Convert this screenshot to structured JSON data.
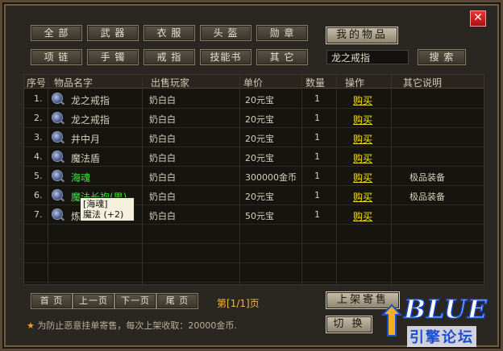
{
  "close_label": "✕",
  "categories_row1": [
    "全 部",
    "武 器",
    "衣 服",
    "头 盔",
    "勋 章"
  ],
  "categories_row2": [
    "项 链",
    "手 镯",
    "戒 指",
    "技能书",
    "其 它"
  ],
  "my_items_label": "我的物品",
  "search": {
    "value": "龙之戒指",
    "button": "搜 索"
  },
  "table": {
    "headers": [
      "序号",
      "物品名字",
      "出售玩家",
      "单价",
      "数量",
      "操作",
      "其它说明"
    ],
    "rows": [
      {
        "idx": "1.",
        "name": "龙之戒指",
        "seller": "奶白白",
        "price": "20元宝",
        "qty": "1",
        "action": "购买",
        "note": "",
        "green": false
      },
      {
        "idx": "2.",
        "name": "龙之戒指",
        "seller": "奶白白",
        "price": "20元宝",
        "qty": "1",
        "action": "购买",
        "note": "",
        "green": false
      },
      {
        "idx": "3.",
        "name": "井中月",
        "seller": "奶白白",
        "price": "20元宝",
        "qty": "1",
        "action": "购买",
        "note": "",
        "green": false
      },
      {
        "idx": "4.",
        "name": "魔法盾",
        "seller": "奶白白",
        "price": "20元宝",
        "qty": "1",
        "action": "购买",
        "note": "",
        "green": false
      },
      {
        "idx": "5.",
        "name": "海魂",
        "seller": "奶白白",
        "price": "300000金币",
        "qty": "1",
        "action": "购买",
        "note": "极品装备",
        "green": true
      },
      {
        "idx": "6.",
        "name": "魔法长袍(男)",
        "seller": "奶白白",
        "price": "20元宝",
        "qty": "1",
        "action": "购买",
        "note": "极品装备",
        "green": true
      },
      {
        "idx": "7.",
        "name": "炼",
        "seller": "奶白白",
        "price": "50元宝",
        "qty": "1",
        "action": "购买",
        "note": "",
        "green": false
      }
    ]
  },
  "tooltip": {
    "line1": "[海魂]",
    "line2": "魔法 (+2)"
  },
  "pager": {
    "first": "首 页",
    "prev": "上一页",
    "next": "下一页",
    "last": "尾 页",
    "info": "第[1/1]页"
  },
  "list_button": "上架寄售",
  "switch_button": "切 换",
  "notice": {
    "star": "★",
    "text": "为防止恶意挂单寄售，每次上架收取：20000金币."
  },
  "logo": {
    "main": "BLUE",
    "sub": "引擎论坛"
  },
  "colors": {
    "accent_yellow": "#f0e020",
    "green_item": "#3ee63e",
    "page_info": "#f0b840"
  }
}
